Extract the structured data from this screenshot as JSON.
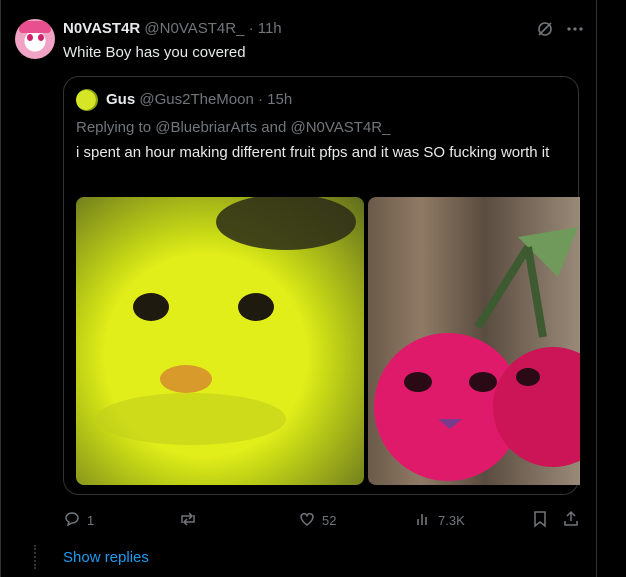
{
  "tweet": {
    "author_name": "N0VAST4R",
    "author_handle": "@N0VAST4R_",
    "time": "· 11h",
    "text": "White Boy has you covered"
  },
  "quote": {
    "author_name": "Gus",
    "author_handle": "@Gus2TheMoon",
    "time": "· 15h",
    "replying_to": "Replying to @BluebriarArts and @N0VAST4R_",
    "text": "i spent an hour making different fruit pfps and it was SO fucking worth it"
  },
  "actions": {
    "replies": "1",
    "reposts": "",
    "likes": "52",
    "views": "7.3K"
  },
  "show_replies": "Show replies",
  "icons": [
    "grok-icon",
    "more-icon",
    "reply-icon",
    "repost-icon",
    "like-icon",
    "views-icon",
    "bookmark-icon",
    "share-icon"
  ]
}
